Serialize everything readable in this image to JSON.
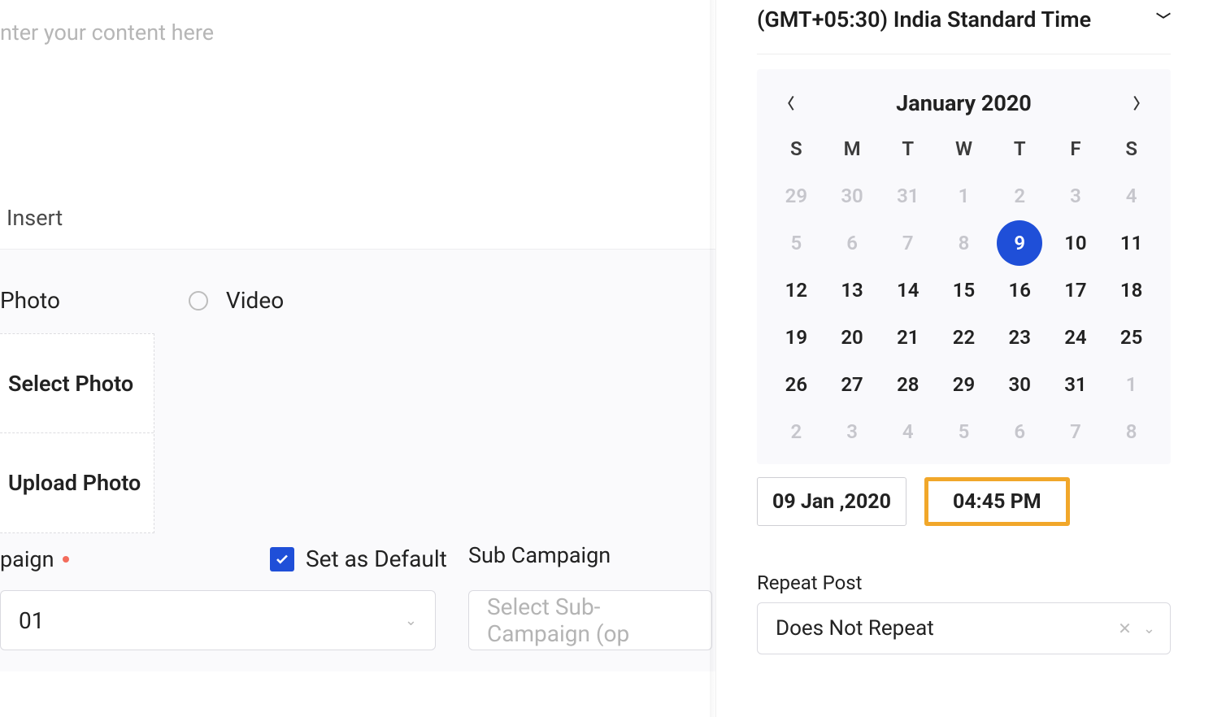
{
  "content": {
    "placeholder": "nter your content here"
  },
  "toolbar": {
    "insert_label": "Insert"
  },
  "media": {
    "photo_label": "Photo",
    "video_label": "Video",
    "select_photo_label": "Select Photo",
    "upload_photo_label": "Upload Photo"
  },
  "campaign": {
    "label": "paign",
    "set_default_label": "Set as Default",
    "selected_value": "01",
    "sub_label": "Sub Campaign",
    "sub_placeholder": "Select Sub-Campaign (op"
  },
  "timezone": {
    "label": "(GMT+05:30) India Standard Time"
  },
  "calendar": {
    "month_title": "January 2020",
    "dow": [
      "S",
      "M",
      "T",
      "W",
      "T",
      "F",
      "S"
    ],
    "grid": [
      {
        "n": "29",
        "muted": true
      },
      {
        "n": "30",
        "muted": true
      },
      {
        "n": "31",
        "muted": true
      },
      {
        "n": "1",
        "muted": true
      },
      {
        "n": "2",
        "muted": true
      },
      {
        "n": "3",
        "muted": true
      },
      {
        "n": "4",
        "muted": true
      },
      {
        "n": "5",
        "muted": true
      },
      {
        "n": "6",
        "muted": true
      },
      {
        "n": "7",
        "muted": true
      },
      {
        "n": "8",
        "muted": true
      },
      {
        "n": "9",
        "selected": true
      },
      {
        "n": "10"
      },
      {
        "n": "11"
      },
      {
        "n": "12"
      },
      {
        "n": "13"
      },
      {
        "n": "14"
      },
      {
        "n": "15"
      },
      {
        "n": "16"
      },
      {
        "n": "17"
      },
      {
        "n": "18"
      },
      {
        "n": "19"
      },
      {
        "n": "20"
      },
      {
        "n": "21"
      },
      {
        "n": "22"
      },
      {
        "n": "23"
      },
      {
        "n": "24"
      },
      {
        "n": "25"
      },
      {
        "n": "26"
      },
      {
        "n": "27"
      },
      {
        "n": "28"
      },
      {
        "n": "29"
      },
      {
        "n": "30"
      },
      {
        "n": "31"
      },
      {
        "n": "1",
        "muted": true
      },
      {
        "n": "2",
        "muted": true
      },
      {
        "n": "3",
        "muted": true
      },
      {
        "n": "4",
        "muted": true
      },
      {
        "n": "5",
        "muted": true
      },
      {
        "n": "6",
        "muted": true
      },
      {
        "n": "7",
        "muted": true
      },
      {
        "n": "8",
        "muted": true
      }
    ]
  },
  "datetime": {
    "date_value": "09 Jan ,2020",
    "time_value": "04:45 PM"
  },
  "repeat": {
    "label": "Repeat Post",
    "value": "Does Not Repeat"
  }
}
